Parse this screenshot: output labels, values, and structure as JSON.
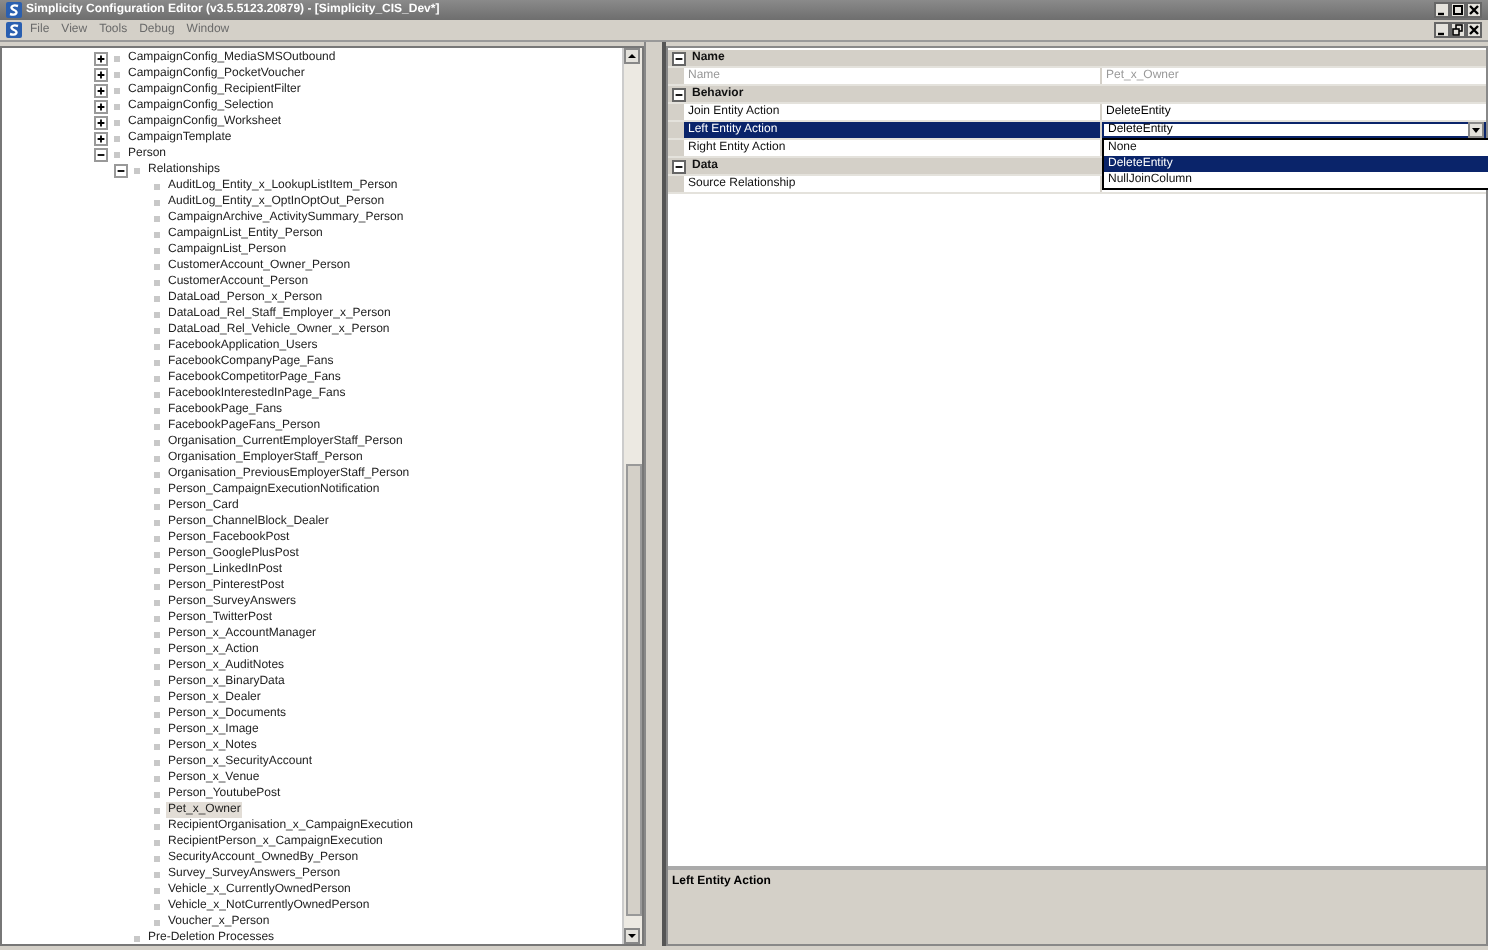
{
  "window": {
    "title": "Simplicity Configuration Editor (v3.5.5123.20879) - [Simplicity_CIS_Dev*]"
  },
  "menu": [
    {
      "label": "File"
    },
    {
      "label": "View"
    },
    {
      "label": "Tools"
    },
    {
      "label": "Debug"
    },
    {
      "label": "Window"
    }
  ],
  "tree": [
    {
      "label": "CampaignConfig_MediaSMSOutbound",
      "expanded": false,
      "selected": false
    },
    {
      "label": "CampaignConfig_PocketVoucher",
      "expanded": false,
      "selected": false
    },
    {
      "label": "CampaignConfig_RecipientFilter",
      "expanded": false,
      "selected": false
    },
    {
      "label": "CampaignConfig_Selection",
      "expanded": false,
      "selected": false
    },
    {
      "label": "CampaignConfig_Worksheet",
      "expanded": false,
      "selected": false
    },
    {
      "label": "CampaignTemplate",
      "expanded": false,
      "selected": false
    },
    {
      "label": "Person",
      "expanded": true,
      "selected": false,
      "children": [
        {
          "label": "Relationships",
          "expanded": true,
          "selected": false,
          "children": [
            {
              "label": "AuditLog_Entity_x_LookupListItem_Person",
              "selected": false
            },
            {
              "label": "AuditLog_Entity_x_OptInOptOut_Person",
              "selected": false
            },
            {
              "label": "CampaignArchive_ActivitySummary_Person",
              "selected": false
            },
            {
              "label": "CampaignList_Entity_Person",
              "selected": false
            },
            {
              "label": "CampaignList_Person",
              "selected": false
            },
            {
              "label": "CustomerAccount_Owner_Person",
              "selected": false
            },
            {
              "label": "CustomerAccount_Person",
              "selected": false
            },
            {
              "label": "DataLoad_Person_x_Person",
              "selected": false
            },
            {
              "label": "DataLoad_Rel_Staff_Employer_x_Person",
              "selected": false
            },
            {
              "label": "DataLoad_Rel_Vehicle_Owner_x_Person",
              "selected": false
            },
            {
              "label": "FacebookApplication_Users",
              "selected": false
            },
            {
              "label": "FacebookCompanyPage_Fans",
              "selected": false
            },
            {
              "label": "FacebookCompetitorPage_Fans",
              "selected": false
            },
            {
              "label": "FacebookInterestedInPage_Fans",
              "selected": false
            },
            {
              "label": "FacebookPage_Fans",
              "selected": false
            },
            {
              "label": "FacebookPageFans_Person",
              "selected": false
            },
            {
              "label": "Organisation_CurrentEmployerStaff_Person",
              "selected": false
            },
            {
              "label": "Organisation_EmployerStaff_Person",
              "selected": false
            },
            {
              "label": "Organisation_PreviousEmployerStaff_Person",
              "selected": false
            },
            {
              "label": "Person_CampaignExecutionNotification",
              "selected": false
            },
            {
              "label": "Person_Card",
              "selected": false
            },
            {
              "label": "Person_ChannelBlock_Dealer",
              "selected": false
            },
            {
              "label": "Person_FacebookPost",
              "selected": false
            },
            {
              "label": "Person_GooglePlusPost",
              "selected": false
            },
            {
              "label": "Person_LinkedInPost",
              "selected": false
            },
            {
              "label": "Person_PinterestPost",
              "selected": false
            },
            {
              "label": "Person_SurveyAnswers",
              "selected": false
            },
            {
              "label": "Person_TwitterPost",
              "selected": false
            },
            {
              "label": "Person_x_AccountManager",
              "selected": false
            },
            {
              "label": "Person_x_Action",
              "selected": false
            },
            {
              "label": "Person_x_AuditNotes",
              "selected": false
            },
            {
              "label": "Person_x_BinaryData",
              "selected": false
            },
            {
              "label": "Person_x_Dealer",
              "selected": false
            },
            {
              "label": "Person_x_Documents",
              "selected": false
            },
            {
              "label": "Person_x_Image",
              "selected": false
            },
            {
              "label": "Person_x_Notes",
              "selected": false
            },
            {
              "label": "Person_x_SecurityAccount",
              "selected": false
            },
            {
              "label": "Person_x_Venue",
              "selected": false
            },
            {
              "label": "Person_YoutubePost",
              "selected": false
            },
            {
              "label": "Pet_x_Owner",
              "selected": true
            },
            {
              "label": "RecipientOrganisation_x_CampaignExecution",
              "selected": false
            },
            {
              "label": "RecipientPerson_x_CampaignExecution",
              "selected": false
            },
            {
              "label": "SecurityAccount_OwnedBy_Person",
              "selected": false
            },
            {
              "label": "Survey_SurveyAnswers_Person",
              "selected": false
            },
            {
              "label": "Vehicle_x_CurrentlyOwnedPerson",
              "selected": false
            },
            {
              "label": "Vehicle_x_NotCurrentlyOwnedPerson",
              "selected": false
            },
            {
              "label": "Voucher_x_Person",
              "selected": false
            }
          ]
        },
        {
          "label": "Pre-Deletion Processes",
          "selected": false
        }
      ]
    }
  ],
  "property_grid": {
    "categories": [
      {
        "name": "Name",
        "expanded": true,
        "properties": [
          {
            "label": "Name",
            "value": "Pet_x_Owner",
            "readonly": true,
            "selected": false
          }
        ]
      },
      {
        "name": "Behavior",
        "expanded": true,
        "properties": [
          {
            "label": "Join Entity Action",
            "value": "DeleteEntity",
            "readonly": false,
            "selected": false
          },
          {
            "label": "Left Entity Action",
            "value": "DeleteEntity",
            "readonly": false,
            "selected": true,
            "dropdown": {
              "options": [
                {
                  "label": "None",
                  "selected": false
                },
                {
                  "label": "DeleteEntity",
                  "selected": true
                },
                {
                  "label": "NullJoinColumn",
                  "selected": false
                }
              ]
            }
          },
          {
            "label": "Right Entity Action",
            "readonly": false,
            "selected": false
          }
        ]
      },
      {
        "name": "Data",
        "expanded": true,
        "properties": [
          {
            "label": "Source Relationship",
            "readonly": false,
            "selected": false
          }
        ]
      }
    ]
  },
  "description": {
    "title": "Left Entity Action"
  }
}
